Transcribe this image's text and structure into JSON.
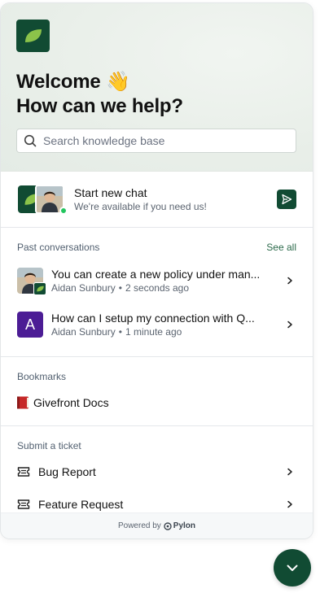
{
  "hero": {
    "welcome": "Welcome 👋",
    "help": "How can we help?",
    "search_placeholder": "Search knowledge base"
  },
  "new_chat": {
    "title": "Start new chat",
    "subtitle": "We're available if you need us!"
  },
  "past_conversations": {
    "heading": "Past conversations",
    "see_all": "See all",
    "items": [
      {
        "title": "You can create a new policy under man...",
        "author": "Aidan Sunbury",
        "time": "2 seconds ago",
        "avatar": "photo"
      },
      {
        "title": "How can I setup my connection with Q...",
        "author": "Aidan Sunbury",
        "time": "1 minute ago",
        "avatar_letter": "A"
      }
    ]
  },
  "bookmarks": {
    "heading": "Bookmarks",
    "items": [
      {
        "label": "Givefront Docs",
        "icon": "red-book-icon"
      }
    ]
  },
  "tickets": {
    "heading": "Submit a ticket",
    "items": [
      {
        "label": "Bug Report",
        "icon": "ticket-icon"
      },
      {
        "label": "Feature Request",
        "icon": "ticket-icon"
      }
    ]
  },
  "footer": {
    "powered_by": "Powered by",
    "brand": "Pylon"
  },
  "colors": {
    "brand": "#114b33",
    "online": "#22c55e",
    "letter_avatar": "#4c1d95",
    "link": "#2d6b4c"
  }
}
